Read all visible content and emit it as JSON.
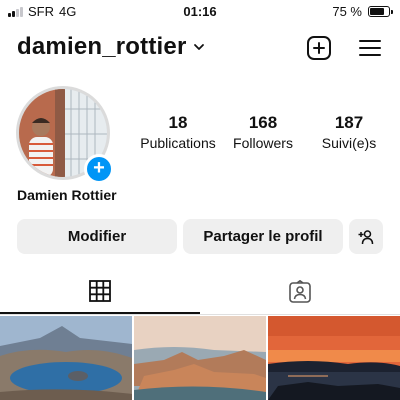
{
  "status_bar": {
    "carrier": "SFR",
    "network": "4G",
    "time": "01:16",
    "battery_percent": "75 %",
    "battery_level": 0.75,
    "signal_bars": 2
  },
  "profile": {
    "username": "damien_rottier",
    "full_name": "Damien Rottier",
    "stats": [
      {
        "value": "18",
        "label": "Publications"
      },
      {
        "value": "168",
        "label": "Followers"
      },
      {
        "value": "187",
        "label": "Suivi(e)s"
      }
    ]
  },
  "actions": {
    "edit_label": "Modifier",
    "share_label": "Partager le profil"
  },
  "tabs": [
    {
      "icon": "grid-icon",
      "active": true
    },
    {
      "icon": "tagged-person-icon",
      "active": false
    }
  ],
  "posts": [
    {
      "icon": "volcano-lake-photo"
    },
    {
      "icon": "island-bay-photo"
    },
    {
      "icon": "sunset-coast-photo"
    }
  ],
  "colors": {
    "accent": "#0095f6",
    "button_bg": "#efefef"
  }
}
